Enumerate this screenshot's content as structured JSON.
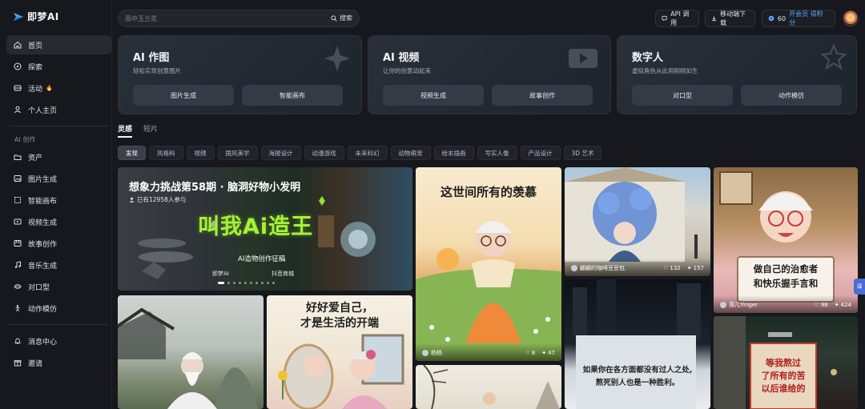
{
  "app": {
    "logo_text": "即梦AI"
  },
  "sidebar": {
    "main_items": [
      {
        "label": "首页",
        "icon": "home-icon"
      },
      {
        "label": "探索",
        "icon": "compass-icon"
      },
      {
        "label": "活动",
        "icon": "activity-icon",
        "badge": "🔥"
      },
      {
        "label": "个人主页",
        "icon": "user-icon"
      }
    ],
    "section_label": "AI 创作",
    "create_items": [
      {
        "label": "资产",
        "icon": "asset-icon"
      },
      {
        "label": "图片生成",
        "icon": "image-icon"
      },
      {
        "label": "智能画布",
        "icon": "canvas-icon"
      },
      {
        "label": "视频生成",
        "icon": "video-icon"
      },
      {
        "label": "故事创作",
        "icon": "story-icon"
      },
      {
        "label": "音乐生成",
        "icon": "music-icon"
      },
      {
        "label": "对口型",
        "icon": "lip-sync-icon"
      },
      {
        "label": "动作模仿",
        "icon": "motion-icon"
      }
    ],
    "bottom_items": [
      {
        "label": "消息中心",
        "icon": "bell-icon"
      },
      {
        "label": "邀请",
        "icon": "invite-icon"
      }
    ]
  },
  "header": {
    "search_placeholder": "雨中玉兰花",
    "search_button": "搜索",
    "api_label": "API 调用",
    "download_label": "移动端下载",
    "credits_value": "60",
    "vip_label": "开会员 得积分"
  },
  "features": [
    {
      "title": "AI 作图",
      "subtitle": "轻松实现创意图片",
      "buttons": [
        "图片生成",
        "智能画布"
      ]
    },
    {
      "title": "AI 视频",
      "subtitle": "让你的创意动起来",
      "buttons": [
        "视频生成",
        "故事创作"
      ]
    },
    {
      "title": "数字人",
      "subtitle": "虚拟角色从此用栩栩如生",
      "buttons": [
        "对口型",
        "动作模仿"
      ]
    }
  ],
  "tabs": [
    "灵感",
    "短片"
  ],
  "chips": [
    "发现",
    "风格码",
    "视频",
    "国风美学",
    "海报设计",
    "动漫游戏",
    "未来科幻",
    "动物萌宠",
    "绘本插画",
    "写实人像",
    "产品设计",
    "3D 艺术"
  ],
  "banner": {
    "title": "想象力挑战第58期 · 脑洞好物小发明",
    "participants": "已有12958人参与",
    "art_text": "叫我Ai造王",
    "caption": "AI造物创作征稿",
    "brand1": "即梦AI",
    "brand2": "抖音商城"
  },
  "gallery": {
    "mirror_text_1": "好好爱自己，",
    "mirror_text_2": "才是生活的开端",
    "field_text": "这世间所有的羡慕",
    "field_author": "杨杨",
    "field_likes": "8",
    "field_remix": "47",
    "flowers_author": "翩翩的咖啡豆豆包",
    "flowers_likes": "132",
    "flowers_remix": "157",
    "sign_text_1": "做自己的治愈者",
    "sign_text_2": "和快乐握手言和",
    "sign_author": "落儿Yinger",
    "sign_likes": "98",
    "sign_remix": "424",
    "night_text_1": "如果你在各方面都没有过人之处,",
    "night_text_2": "熬死别人也是一种胜利。",
    "alley_text_1": "等我熬过",
    "alley_text_2": "了所有的苦",
    "alley_text_3": "以后谁给的"
  },
  "side_tab_label": "译",
  "colors": {
    "background": "#16181d",
    "accent": "#5fa8ff",
    "banner_art": "#a6f23a"
  }
}
